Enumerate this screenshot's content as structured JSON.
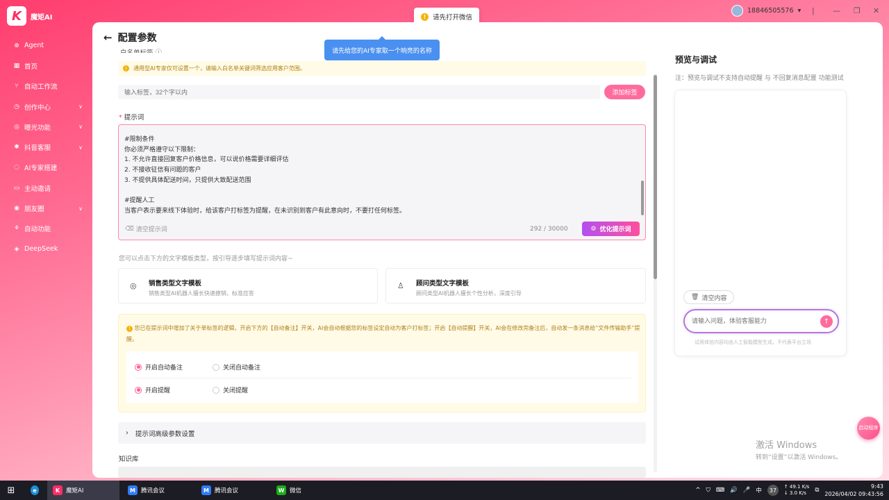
{
  "app": {
    "logo_letter": "K",
    "logo_text": "魔矩AI"
  },
  "sidebar": {
    "items": [
      {
        "label": "Agent",
        "icon": "⊕",
        "chevron": false
      },
      {
        "label": "首页",
        "icon": "▦",
        "chevron": false
      },
      {
        "label": "自动工作流",
        "icon": "⑂",
        "chevron": false
      },
      {
        "label": "创作中心",
        "icon": "◷",
        "chevron": true
      },
      {
        "label": "曝光功能",
        "icon": "◎",
        "chevron": true
      },
      {
        "label": "抖音客服",
        "icon": "✱",
        "chevron": true
      },
      {
        "label": "AI专家搭建",
        "icon": "◌",
        "chevron": false
      },
      {
        "label": "主动邀请",
        "icon": "▭",
        "chevron": false
      },
      {
        "label": "朋友圈",
        "icon": "◉",
        "chevron": true
      },
      {
        "label": "自动功能",
        "icon": "⚘",
        "chevron": false
      },
      {
        "label": "DeepSeek",
        "icon": "◈",
        "chevron": false
      }
    ]
  },
  "toast": {
    "text": "请先打开微信"
  },
  "user": {
    "phone": "18846505576"
  },
  "header": {
    "title": "配置参数"
  },
  "tooltip": {
    "text": "请先给您的AI专家取一个响亮的名称"
  },
  "form": {
    "cut_label": "白名单标签 ⓘ",
    "notice": "通用型AI专家仅可设置一个，请输入白名单关键词筛选应用客户范围。",
    "tag_placeholder": "输入标签，32个字以内",
    "tag_button": "添加标签",
    "prompt_label": "提示词",
    "prompt_text": "#限制条件\n你必须严格遵守以下限制：\n1. 不允许直接回复客户价格信息，可以说价格需要详细评估\n2. 不接收征信有问题的客户\n3. 不提供具体配送时间，只提供大致配送范围\n\n#提醒人工\n当客户表示要来线下体验时，给该客户打标签为提醒，在未识别到客户有此意向时，不要打任何标签。",
    "clear_prompt": "清空提示词",
    "char_count": "292 / 30000",
    "optimize_button": "优化提示词",
    "hint": "您可以点击下方的文字模板类型，按引导逐步填写提示词内容~",
    "templates": [
      {
        "title": "销售类型文字模板",
        "desc": "销售类型AI机器人擅长快速撩销，标准应答",
        "icon": "◎"
      },
      {
        "title": "顾问类型文字模板",
        "desc": "顾问类型AI机器人擅长个性分析，深度引导",
        "icon": "♙"
      }
    ],
    "notice2": "您已在提示词中增加了关于单标签的逻辑，开启下方的【自动备注】开关，AI会自动根据您的标签设定自动为客户打标签；开启【自动提醒】开关，AI会在修改完备注后，自动发一条消息给“文件传输助手”提醒。",
    "radios": {
      "auto_note_on": "开启自动备注",
      "auto_note_off": "关闭自动备注",
      "remind_on": "开启提醒",
      "remind_off": "关闭提醒"
    },
    "advanced": "提示词高级参数设置",
    "knowledge": "知识库"
  },
  "preview": {
    "title": "预览与调试",
    "note": "注：预览与调试不支持自动提醒 与 不回复消息配置 功能测试",
    "clear": "清空内容",
    "input_placeholder": "请输入问题，体验客服能力",
    "disclaimer": "试用体验内容均由人工智能模型生成，不代表平台立场"
  },
  "float_button": "启动程序",
  "watermark": {
    "line1": "激活 Windows",
    "line2": "转到“设置”以激活 Windows。"
  },
  "taskbar": {
    "apps": [
      {
        "label": "魔矩AI",
        "color": "#ff2d65",
        "glyph": "K"
      },
      {
        "label": "腾讯会议",
        "color": "#2f7cf6",
        "glyph": "M"
      },
      {
        "label": "腾讯会议",
        "color": "#2f7cf6",
        "glyph": "M"
      },
      {
        "label": "微信",
        "color": "#1aad19",
        "glyph": "W"
      }
    ],
    "ime": "中",
    "badge": "37",
    "net_up": "↑ 49.1 K/s",
    "net_down": "↓ 3.0 K/s",
    "time": "9:43",
    "datetime": "2026/04/02 09:43:56"
  }
}
